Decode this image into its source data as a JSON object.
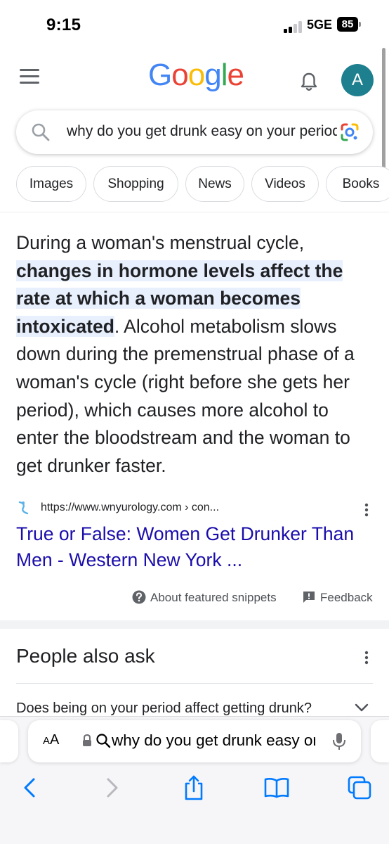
{
  "status_bar": {
    "time": "9:15",
    "network": "5GE",
    "battery": "85"
  },
  "header": {
    "logo_letters": [
      {
        "char": "G",
        "color": "#4285F4"
      },
      {
        "char": "o",
        "color": "#EA4335"
      },
      {
        "char": "o",
        "color": "#FBBC05"
      },
      {
        "char": "g",
        "color": "#4285F4"
      },
      {
        "char": "l",
        "color": "#34A853"
      },
      {
        "char": "e",
        "color": "#EA4335"
      }
    ],
    "avatar_initial": "A"
  },
  "search": {
    "query": "why do you get drunk easy on your period"
  },
  "chips": [
    {
      "label": "Images"
    },
    {
      "label": "Shopping"
    },
    {
      "label": "News"
    },
    {
      "label": "Videos"
    },
    {
      "label": "Books"
    }
  ],
  "featured_snippet": {
    "text_before": "During a woman's menstrual cycle, ",
    "highlighted_text": "changes in hormone levels affect the rate at which a woman becomes intoxicated",
    "text_after": ". Alcohol metabolism slows down during the premenstrual phase of a woman's cycle (right before she gets her period), which causes more alcohol to enter the bloodstream and the woman to get drunker faster.",
    "source_url": "https://www.wnyurology.com › con...",
    "source_title": "True or False: Women Get Drunker Than Men - Western New York ...",
    "about_label": "About featured snippets",
    "feedback_label": "Feedback"
  },
  "people_also_ask": {
    "title": "People also ask",
    "first_question": "Does being on your period affect getting drunk?"
  },
  "safari": {
    "aa_label": "AA",
    "address_text": "why do you get drunk easy on your period"
  },
  "colors": {
    "link": "#1a0dab",
    "highlight_bg": "#e8f0fe",
    "ios_blue": "#007aff",
    "avatar_bg": "#1e7f8e"
  }
}
